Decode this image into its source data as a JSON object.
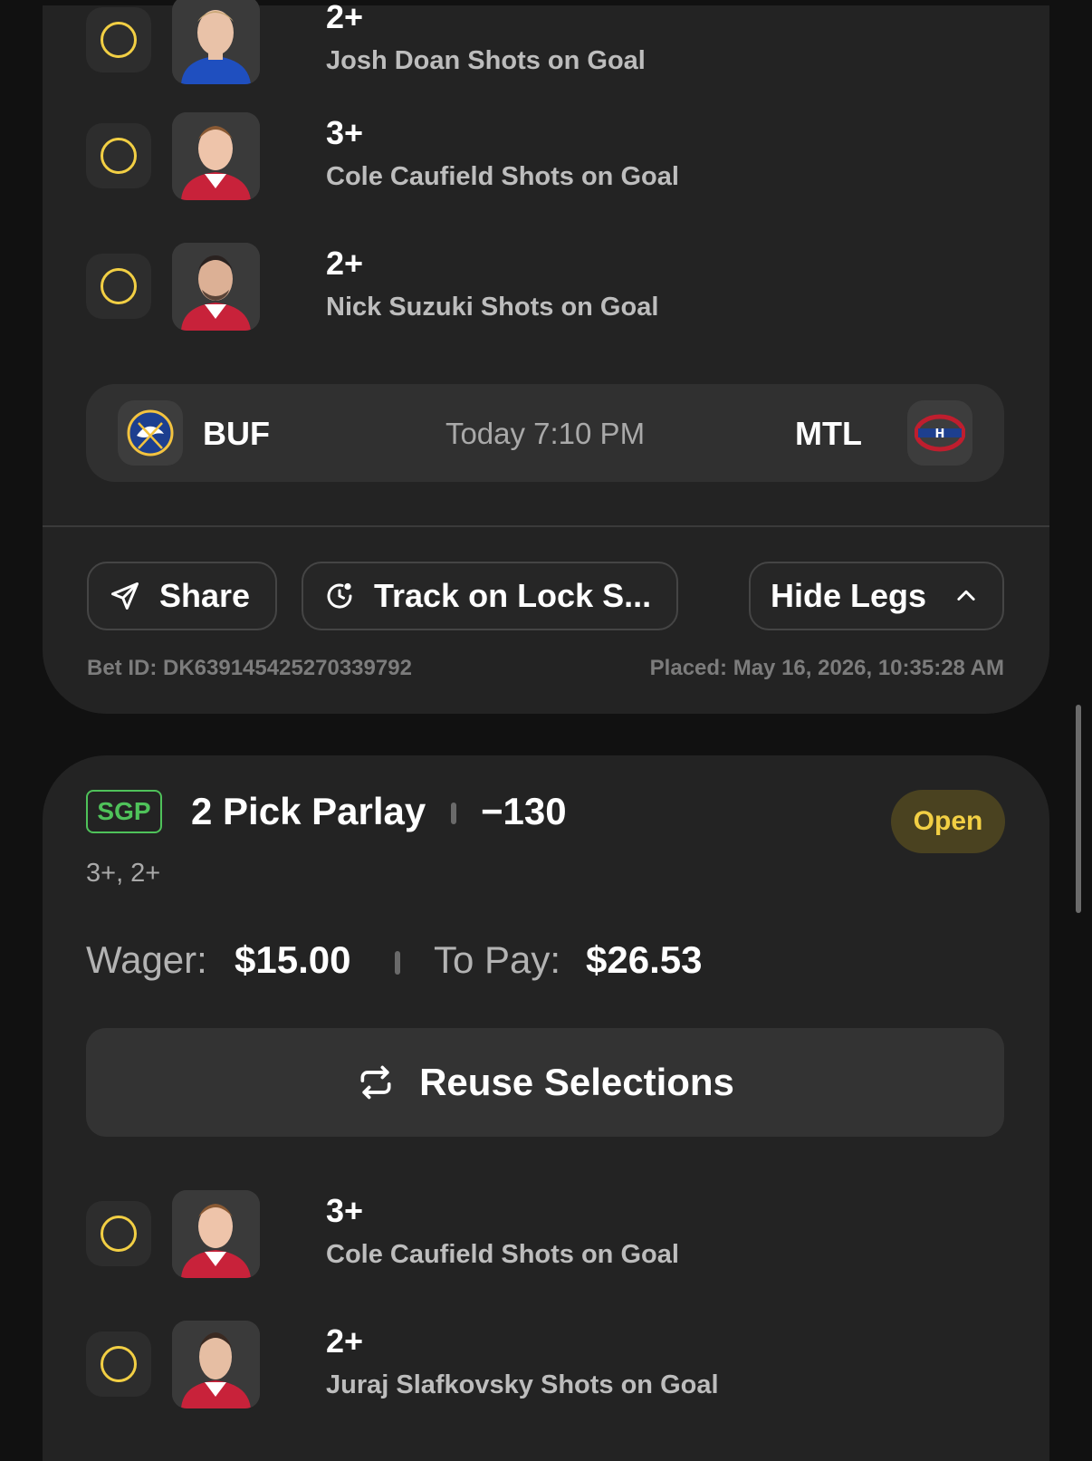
{
  "top_card": {
    "legs": [
      {
        "line": "2+",
        "description": "Josh Doan Shots on Goal",
        "jersey": "blue"
      },
      {
        "line": "3+",
        "description": "Cole Caufield Shots on Goal",
        "jersey": "red"
      },
      {
        "line": "2+",
        "description": "Nick Suzuki Shots on Goal",
        "jersey": "red"
      }
    ],
    "game": {
      "away_code": "BUF",
      "home_code": "MTL",
      "time": "Today 7:10 PM"
    },
    "actions": {
      "share_label": "Share",
      "track_label": "Track on Lock S...",
      "hide_legs_label": "Hide Legs"
    },
    "bet_id": "Bet ID: DK639145425270339792",
    "placed": "Placed: May 16, 2026, 10:35:28 AM"
  },
  "bottom_card": {
    "badge": "SGP",
    "title": "2 Pick Parlay",
    "odds": "−130",
    "status": "Open",
    "lines_summary": "3+, 2+",
    "wager_label": "Wager:",
    "wager_value": "$15.00",
    "to_pay_label": "To Pay:",
    "to_pay_value": "$26.53",
    "reuse_label": "Reuse Selections",
    "legs": [
      {
        "line": "3+",
        "description": "Cole Caufield Shots on Goal",
        "jersey": "red"
      },
      {
        "line": "2+",
        "description": "Juraj Slafkovsky Shots on Goal",
        "jersey": "red"
      }
    ]
  },
  "colors": {
    "background": "#111111",
    "card": "#232323",
    "pending_ring": "#f2cf44",
    "sgp_green": "#4fc25a",
    "open_badge_bg": "#4a4220"
  },
  "icons": [
    "send-icon",
    "clock-icon",
    "chevron-up-icon",
    "repeat-icon",
    "sabres-logo",
    "canadiens-logo"
  ]
}
